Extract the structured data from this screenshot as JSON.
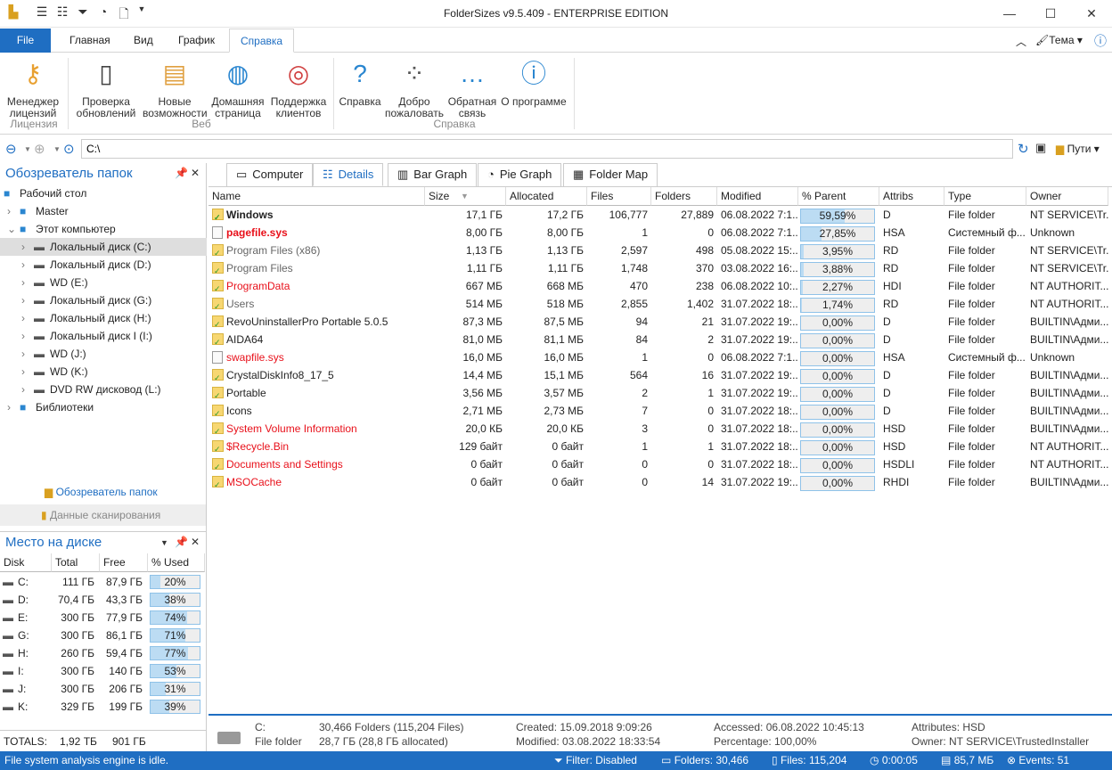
{
  "window": {
    "title": "FolderSizes v9.5.409 - ENTERPRISE EDITION",
    "quick_access": [
      "app-logo-icon",
      "report-icon",
      "search-list-icon",
      "filter-icon",
      "chart-icon",
      "search-doc-icon",
      "dropdown-icon"
    ]
  },
  "tabs": [
    {
      "label": "File"
    },
    {
      "label": "Главная"
    },
    {
      "label": "Вид"
    },
    {
      "label": "График"
    },
    {
      "label": "Справка"
    }
  ],
  "ribbon_right": {
    "theme": "Тема"
  },
  "ribbon": {
    "buttons": [
      {
        "label1": "Менеджер",
        "label2": "лицензий",
        "icon": "key-icon"
      },
      {
        "label1": "Проверка",
        "label2": "обновлений",
        "icon": "update-icon"
      },
      {
        "label1": "Новые",
        "label2": "возможности",
        "icon": "notes-icon"
      },
      {
        "label1": "Домашняя",
        "label2": "страница",
        "icon": "globe-icon"
      },
      {
        "label1": "Поддержка",
        "label2": "клиентов",
        "icon": "support-icon"
      },
      {
        "label1": "Справка",
        "label2": "",
        "icon": "help-icon"
      },
      {
        "label1": "Добро",
        "label2": "пожаловать",
        "icon": "footprints-icon"
      },
      {
        "label1": "Обратная",
        "label2": "связь",
        "icon": "feedback-icon"
      },
      {
        "label1": "О программе",
        "label2": "",
        "icon": "info-icon"
      }
    ],
    "groups": [
      "Лицензия",
      "Веб",
      "Справка"
    ]
  },
  "address": {
    "value": "C:\\",
    "paths_label": "Пути"
  },
  "folder_panel": {
    "title": "Обозреватель папок",
    "tree": [
      {
        "label": "Рабочий стол",
        "level": 0
      },
      {
        "label": "Master",
        "level": 1
      },
      {
        "label": "Этот компьютер",
        "level": 1
      },
      {
        "label": "Локальный диск (C:)",
        "level": 2,
        "selected": true
      },
      {
        "label": "Локальный диск (D:)",
        "level": 2
      },
      {
        "label": "WD (E:)",
        "level": 2
      },
      {
        "label": "Локальный диск (G:)",
        "level": 2
      },
      {
        "label": "Локальный диск (H:)",
        "level": 2
      },
      {
        "label": "Локальный диск I (I:)",
        "level": 2
      },
      {
        "label": "WD (J:)",
        "level": 2
      },
      {
        "label": "WD (K:)",
        "level": 2
      },
      {
        "label": "DVD RW дисковод (L:)",
        "level": 2
      },
      {
        "label": "Библиотеки",
        "level": 1
      }
    ],
    "tab_browser": "Обозреватель папок",
    "tab_scan": "Данные сканирования"
  },
  "disk_panel": {
    "title": "Место на диске",
    "headers": [
      "Disk",
      "Total",
      "Free",
      "% Used"
    ],
    "rows": [
      {
        "disk": "C:",
        "total": "111 ГБ",
        "free": "87,9 ГБ",
        "used": "20%",
        "pct": 20
      },
      {
        "disk": "D:",
        "total": "70,4 ГБ",
        "free": "43,3 ГБ",
        "used": "38%",
        "pct": 38
      },
      {
        "disk": "E:",
        "total": "300 ГБ",
        "free": "77,9 ГБ",
        "used": "74%",
        "pct": 74
      },
      {
        "disk": "G:",
        "total": "300 ГБ",
        "free": "86,1 ГБ",
        "used": "71%",
        "pct": 71
      },
      {
        "disk": "H:",
        "total": "260 ГБ",
        "free": "59,4 ГБ",
        "used": "77%",
        "pct": 77
      },
      {
        "disk": "I:",
        "total": "300 ГБ",
        "free": "140 ГБ",
        "used": "53%",
        "pct": 53
      },
      {
        "disk": "J:",
        "total": "300 ГБ",
        "free": "206 ГБ",
        "used": "31%",
        "pct": 31
      },
      {
        "disk": "K:",
        "total": "329 ГБ",
        "free": "199 ГБ",
        "used": "39%",
        "pct": 39
      }
    ],
    "totals_label": "TOTALS:",
    "totals_total": "1,92 ТБ",
    "totals_free": "901 ГБ"
  },
  "view_tabs": [
    "Computer",
    "Details",
    "Bar Graph",
    "Pie Graph",
    "Folder Map"
  ],
  "table": {
    "headers": [
      "Name",
      "Size",
      "Allocated",
      "Files",
      "Folders",
      "Modified",
      "% Parent",
      "Attribs",
      "Type",
      "Owner"
    ],
    "rows": [
      {
        "name": "Windows",
        "style": "bold",
        "kind": "folder",
        "size": "17,1 ГБ",
        "alloc": "17,2 ГБ",
        "files": "106,777",
        "folders": "27,889",
        "modified": "06.08.2022 7:1...",
        "parent": "59,59%",
        "pct": 59.59,
        "attr": "D",
        "type": "File folder",
        "owner": "NT SERVICE\\Tr..."
      },
      {
        "name": "pagefile.sys",
        "style": "boldred",
        "kind": "file",
        "size": "8,00 ГБ",
        "alloc": "8,00 ГБ",
        "files": "1",
        "folders": "0",
        "modified": "06.08.2022 7:1...",
        "parent": "27,85%",
        "pct": 27.85,
        "attr": "HSA",
        "type": "Системный ф...",
        "owner": "Unknown"
      },
      {
        "name": "Program Files (x86)",
        "style": "gray",
        "kind": "folder",
        "size": "1,13 ГБ",
        "alloc": "1,13 ГБ",
        "files": "2,597",
        "folders": "498",
        "modified": "05.08.2022 15:...",
        "parent": "3,95%",
        "pct": 3.95,
        "attr": "RD",
        "type": "File folder",
        "owner": "NT SERVICE\\Tr..."
      },
      {
        "name": "Program Files",
        "style": "gray",
        "kind": "folder",
        "size": "1,11 ГБ",
        "alloc": "1,11 ГБ",
        "files": "1,748",
        "folders": "370",
        "modified": "03.08.2022 16:...",
        "parent": "3,88%",
        "pct": 3.88,
        "attr": "RD",
        "type": "File folder",
        "owner": "NT SERVICE\\Tr..."
      },
      {
        "name": "ProgramData",
        "style": "red",
        "kind": "folder",
        "size": "667 МБ",
        "alloc": "668 МБ",
        "files": "470",
        "folders": "238",
        "modified": "06.08.2022 10:...",
        "parent": "2,27%",
        "pct": 2.27,
        "attr": "HDI",
        "type": "File folder",
        "owner": "NT AUTHORIT..."
      },
      {
        "name": "Users",
        "style": "gray",
        "kind": "folder",
        "size": "514 МБ",
        "alloc": "518 МБ",
        "files": "2,855",
        "folders": "1,402",
        "modified": "31.07.2022 18:...",
        "parent": "1,74%",
        "pct": 1.74,
        "attr": "RD",
        "type": "File folder",
        "owner": "NT AUTHORIT..."
      },
      {
        "name": "RevoUninstallerPro Portable 5.0.5",
        "style": "",
        "kind": "folder",
        "size": "87,3 МБ",
        "alloc": "87,5 МБ",
        "files": "94",
        "folders": "21",
        "modified": "31.07.2022 19:...",
        "parent": "0,00%",
        "pct": 0,
        "attr": "D",
        "type": "File folder",
        "owner": "BUILTIN\\Адми..."
      },
      {
        "name": "AIDA64",
        "style": "",
        "kind": "folder",
        "size": "81,0 МБ",
        "alloc": "81,1 МБ",
        "files": "84",
        "folders": "2",
        "modified": "31.07.2022 19:...",
        "parent": "0,00%",
        "pct": 0,
        "attr": "D",
        "type": "File folder",
        "owner": "BUILTIN\\Адми..."
      },
      {
        "name": "swapfile.sys",
        "style": "red",
        "kind": "file",
        "size": "16,0 МБ",
        "alloc": "16,0 МБ",
        "files": "1",
        "folders": "0",
        "modified": "06.08.2022 7:1...",
        "parent": "0,00%",
        "pct": 0,
        "attr": "HSA",
        "type": "Системный ф...",
        "owner": "Unknown"
      },
      {
        "name": "CrystalDiskInfo8_17_5",
        "style": "",
        "kind": "folder",
        "size": "14,4 МБ",
        "alloc": "15,1 МБ",
        "files": "564",
        "folders": "16",
        "modified": "31.07.2022 19:...",
        "parent": "0,00%",
        "pct": 0,
        "attr": "D",
        "type": "File folder",
        "owner": "BUILTIN\\Адми..."
      },
      {
        "name": "Portable",
        "style": "",
        "kind": "folder",
        "size": "3,56 МБ",
        "alloc": "3,57 МБ",
        "files": "2",
        "folders": "1",
        "modified": "31.07.2022 19:...",
        "parent": "0,00%",
        "pct": 0,
        "attr": "D",
        "type": "File folder",
        "owner": "BUILTIN\\Адми..."
      },
      {
        "name": "Icons",
        "style": "",
        "kind": "folder",
        "size": "2,71 МБ",
        "alloc": "2,73 МБ",
        "files": "7",
        "folders": "0",
        "modified": "31.07.2022 18:...",
        "parent": "0,00%",
        "pct": 0,
        "attr": "D",
        "type": "File folder",
        "owner": "BUILTIN\\Адми..."
      },
      {
        "name": "System Volume Information",
        "style": "red",
        "kind": "folder",
        "size": "20,0 КБ",
        "alloc": "20,0 КБ",
        "files": "3",
        "folders": "0",
        "modified": "31.07.2022 18:...",
        "parent": "0,00%",
        "pct": 0,
        "attr": "HSD",
        "type": "File folder",
        "owner": "BUILTIN\\Адми..."
      },
      {
        "name": "$Recycle.Bin",
        "style": "red",
        "kind": "folder",
        "size": "129 байт",
        "alloc": "0 байт",
        "files": "1",
        "folders": "1",
        "modified": "31.07.2022 18:...",
        "parent": "0,00%",
        "pct": 0,
        "attr": "HSD",
        "type": "File folder",
        "owner": "NT AUTHORIT..."
      },
      {
        "name": "Documents and Settings",
        "style": "red",
        "kind": "folder",
        "size": "0 байт",
        "alloc": "0 байт",
        "files": "0",
        "folders": "0",
        "modified": "31.07.2022 18:...",
        "parent": "0,00%",
        "pct": 0,
        "attr": "HSDLI",
        "type": "File folder",
        "owner": "NT AUTHORIT..."
      },
      {
        "name": "MSOCache",
        "style": "red",
        "kind": "folder",
        "size": "0 байт",
        "alloc": "0 байт",
        "files": "0",
        "folders": "14",
        "modified": "31.07.2022 19:...",
        "parent": "0,00%",
        "pct": 0,
        "attr": "RHDI",
        "type": "File folder",
        "owner": "BUILTIN\\Адми..."
      }
    ]
  },
  "summary": {
    "drive": "C:",
    "kind": "File folder",
    "folders": "30,466 Folders (115,204 Files)",
    "size": "28,7 ГБ (28,8 ГБ allocated)",
    "created": "Created: 15.09.2018 9:09:26",
    "modified": "Modified: 03.08.2022 18:33:54",
    "accessed": "Accessed: 06.08.2022 10:45:13",
    "percentage": "Percentage: 100,00%",
    "attributes": "Attributes: HSD",
    "owner": "Owner: NT SERVICE\\TrustedInstaller"
  },
  "status": {
    "message": "File system analysis engine is idle.",
    "filter": "Filter: Disabled",
    "folders": "Folders: 30,466",
    "files": "Files: 115,204",
    "time": "0:00:05",
    "memory": "85,7 МБ",
    "events": "Events: 51"
  },
  "colors": {
    "accent": "#1f6ec2",
    "red": "#e8101a",
    "bar_fill": "#bcdcf3"
  }
}
